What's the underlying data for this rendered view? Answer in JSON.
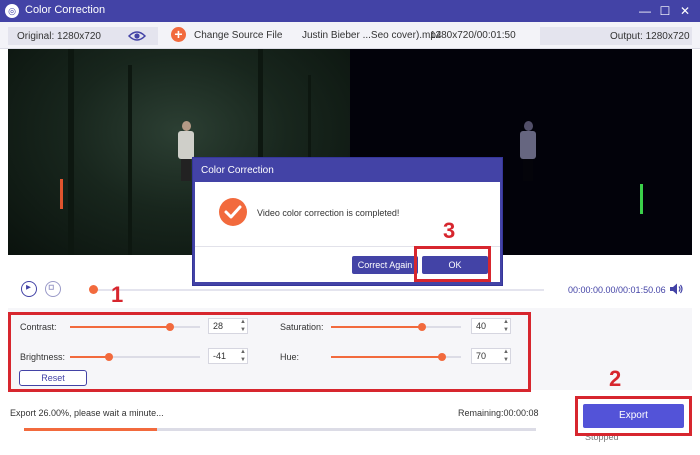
{
  "window": {
    "title": "Color Correction",
    "minimize_glyph": "—",
    "maximize_glyph": "☐",
    "close_glyph": "✕"
  },
  "infobar": {
    "original_label": "Original: 1280x720",
    "change_source": "Change Source File",
    "file_name": "Justin Bieber ...Seo cover).mp4",
    "file_meta": "1280x720/00:01:50",
    "output_label": "Output: 1280x720"
  },
  "dialog": {
    "title": "Color Correction",
    "message": "Video color correction is completed!",
    "correct_again": "Correct Again",
    "ok": "OK"
  },
  "playback": {
    "time": "00:00:00.00/00:01:50.06"
  },
  "controls": {
    "contrast": {
      "label": "Contrast:",
      "value": "28",
      "level": 0.77
    },
    "brightness": {
      "label": "Brightness:",
      "value": "-41",
      "level": 0.3
    },
    "saturation": {
      "label": "Saturation:",
      "value": "40",
      "level": 0.7
    },
    "hue": {
      "label": "Hue:",
      "value": "70",
      "level": 0.85
    },
    "reset": "Reset"
  },
  "export": {
    "status": "Export 26.00%, please wait a minute...",
    "remaining": "Remaining:00:00:08",
    "progress": 0.26,
    "button": "Export",
    "state": "Stopped"
  },
  "annotations": [
    "1",
    "2",
    "3"
  ],
  "colors": {
    "accent": "#4343a6",
    "orange": "#f26a3d",
    "annotation_red": "#d7262e"
  },
  "icons": {
    "app": "app-logo-icon",
    "eye": "eye-icon",
    "add": "plus-circle-icon",
    "play": "play-icon",
    "stop": "stop-icon",
    "volume": "volume-icon",
    "check": "checkmark-icon"
  }
}
